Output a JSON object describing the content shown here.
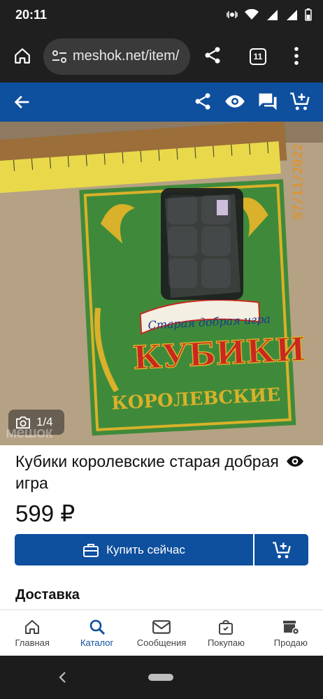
{
  "status_bar": {
    "time": "20:11"
  },
  "browser": {
    "url": "meshok.net/item/",
    "tab_count": "11"
  },
  "product": {
    "photo_counter": "1/4",
    "title": "Кубики королевские старая добрая игра",
    "price": "599 ₽",
    "buy_label": "Купить сейчас",
    "delivery_heading": "Доставка"
  },
  "photo_content": {
    "card_top_text": "Старая добрая игра",
    "card_title": "КУБИКИ",
    "card_subtitle": "КОРОЛЕВСКИЕ",
    "date_stamp": "07/11/2022",
    "watermark": "мешок",
    "colors": {
      "card_green": "#3f8a3a",
      "card_gold": "#d9b12a",
      "card_red": "#c8281f",
      "ruler_yellow": "#e9d94a"
    }
  },
  "bottom_nav": {
    "items": [
      {
        "label": "Главная",
        "icon": "home-icon"
      },
      {
        "label": "Каталог",
        "icon": "search-icon"
      },
      {
        "label": "Сообщения",
        "icon": "mail-icon"
      },
      {
        "label": "Покупаю",
        "icon": "shopping-bag-icon"
      },
      {
        "label": "Продаю",
        "icon": "store-settings-icon"
      }
    ]
  },
  "colors": {
    "brand_blue": "#0e4f9e",
    "browser_dark": "#1f1f1f"
  }
}
